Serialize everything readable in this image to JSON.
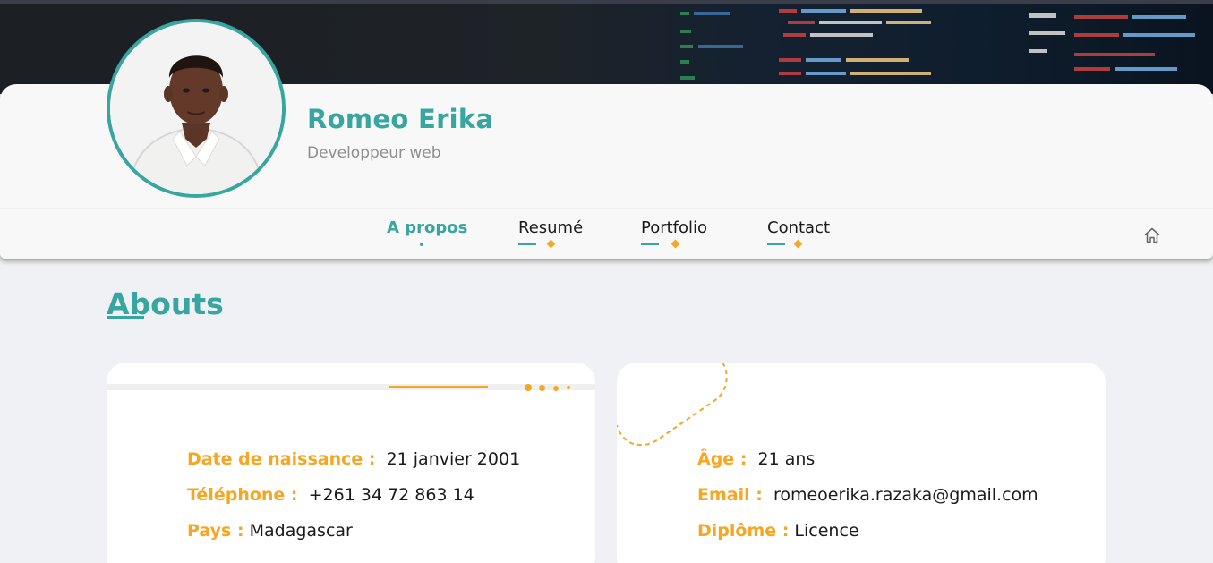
{
  "profile": {
    "name": "Romeo Erika",
    "role": "Developpeur web"
  },
  "nav": {
    "items": [
      {
        "label": "A propos",
        "active": true
      },
      {
        "label": "Resumé",
        "active": false
      },
      {
        "label": "Portfolio",
        "active": false
      },
      {
        "label": "Contact",
        "active": false
      }
    ],
    "home_icon": "home-icon"
  },
  "section": {
    "title": "Abouts"
  },
  "info_left": [
    {
      "label": "Date de naissance :",
      "value": "21 janvier 2001"
    },
    {
      "label": "Téléphone :",
      "value": "+261 34 72 863 14"
    },
    {
      "label": "Pays :",
      "value": "Madagascar"
    }
  ],
  "info_right": [
    {
      "label": "Âge :",
      "value": "21 ans"
    },
    {
      "label": "Email :",
      "value": "romeoerika.razaka@gmail.com"
    },
    {
      "label": "Diplôme :",
      "value": "Licence"
    }
  ],
  "colors": {
    "accent": "#38a6a0",
    "highlight": "#f5a623",
    "background": "#eff1f4"
  }
}
